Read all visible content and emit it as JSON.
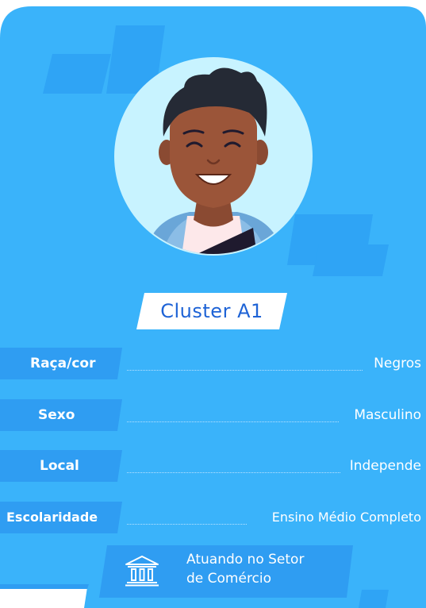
{
  "card": {
    "title": "Cluster A1",
    "avatar_icon": "person-portrait-icon"
  },
  "attributes": [
    {
      "label": "Raça/cor",
      "value": "Negros"
    },
    {
      "label": "Sexo",
      "value": "Masculino"
    },
    {
      "label": "Local",
      "value": "Independe"
    },
    {
      "label": "Escolaridade",
      "value": "Ensino Médio Completo"
    }
  ],
  "sector": {
    "icon": "bank-building-icon",
    "line1": "Atuando no Setor",
    "line2": "de Comércio"
  },
  "colors": {
    "card_background": "#3ab3fa",
    "accent_dark": "#2f9df2",
    "title_text": "#1e63d6",
    "avatar_circle": "#c8f3ff"
  }
}
